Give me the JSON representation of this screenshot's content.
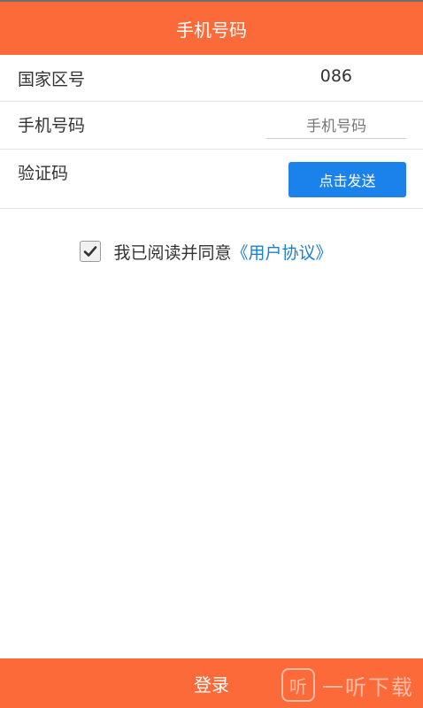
{
  "header": {
    "title": "手机号码"
  },
  "form": {
    "country_code": {
      "label": "国家区号",
      "value": "086"
    },
    "phone": {
      "label": "手机号码",
      "placeholder": "手机号码"
    },
    "verification": {
      "label": "验证码",
      "send_button": "点击发送"
    }
  },
  "agreement": {
    "checked": true,
    "text": "我已阅读并同意",
    "link": "《用户协议》"
  },
  "footer": {
    "login_button": "登录"
  },
  "watermark": {
    "icon_glyph": "听",
    "text": "一听下载"
  },
  "colors": {
    "header_bg": "#fd6a39",
    "button_blue": "#1a82ea",
    "link_blue": "#1a7fd6"
  }
}
